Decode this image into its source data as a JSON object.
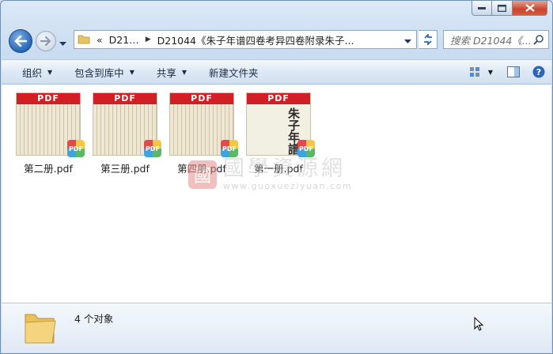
{
  "window": {
    "caption_buttons": [
      "minimize",
      "maximize",
      "close"
    ]
  },
  "nav": {
    "breadcrumb_overflow": "«",
    "crumbs": [
      "D21…",
      "D21044《朱子年谱四卷考异四卷附录朱子..."
    ],
    "search_placeholder": "搜索 D21044《..."
  },
  "toolbar": {
    "organize": "组织",
    "include_in_library": "包含到库中",
    "share": "共享",
    "new_folder": "新建文件夹"
  },
  "files": [
    {
      "name": "第二册.pdf",
      "banner": "PDF",
      "badge": "PDF"
    },
    {
      "name": "第三册.pdf",
      "banner": "PDF",
      "badge": "PDF"
    },
    {
      "name": "第四册.pdf",
      "banner": "PDF",
      "badge": "PDF"
    },
    {
      "name": "第一册.pdf",
      "banner": "PDF",
      "badge": "PDF",
      "cover_text": "朱子年譜"
    }
  ],
  "watermark": {
    "seal": "國",
    "chinese": "國學資源網",
    "url": "www.guoxueziyuan.com"
  },
  "details": {
    "count": "4 个对象"
  },
  "colors": {
    "pdf_red": "#d21f25",
    "chrome_blue": "#cfe0f2"
  }
}
